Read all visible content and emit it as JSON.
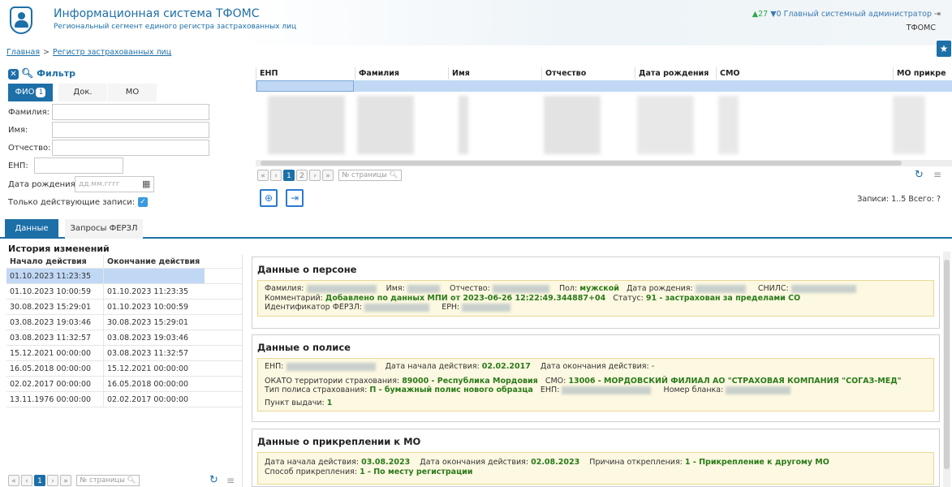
{
  "app": {
    "title": "Информационная система ТФОМС",
    "subtitle": "Региональный сегмент единого регистра застрахованных лиц"
  },
  "user": {
    "up_count": "▲27",
    "down_count": "▼0",
    "role": "Главный системный администратор",
    "org": "ТФОМС"
  },
  "breadcrumb": {
    "home": "Главная",
    "sep": ">",
    "current": "Регистр застрахованных лиц"
  },
  "filter": {
    "title": "Фильтр",
    "tabs": [
      {
        "label": "ФИО",
        "badge": "1"
      },
      {
        "label": "Док."
      },
      {
        "label": "МО"
      }
    ],
    "fields": {
      "surname": "Фамилия:",
      "name": "Имя:",
      "patronymic": "Отчество:",
      "enp": "ЕНП:",
      "birthdate": "Дата рождения:",
      "birthdate_placeholder": "дд.мм.гггг",
      "only_active": "Только действующие записи:"
    }
  },
  "grid": {
    "columns": [
      "ЕНП",
      "Фамилия",
      "Имя",
      "Отчество",
      "Дата рождения",
      "СМО",
      "МО прикре"
    ],
    "pager": {
      "pages": [
        "1",
        "2"
      ],
      "page_placeholder": "№ страницы"
    },
    "records": "Записи: 1..5 Всего: ?"
  },
  "bottom_tabs": [
    "Данные",
    "Запросы ФЕРЗЛ"
  ],
  "history": {
    "title": "История изменений",
    "col_start": "Начало действия",
    "col_end": "Окончание действия",
    "rows": [
      {
        "start": "01.10.2023 11:23:35",
        "end": ""
      },
      {
        "start": "01.10.2023 10:00:59",
        "end": "01.10.2023 11:23:35"
      },
      {
        "start": "30.08.2023 15:29:01",
        "end": "01.10.2023 10:00:59"
      },
      {
        "start": "03.08.2023 19:03:46",
        "end": "30.08.2023 15:29:01"
      },
      {
        "start": "03.08.2023 11:32:57",
        "end": "03.08.2023 19:03:46"
      },
      {
        "start": "15.12.2021 00:00:00",
        "end": "03.08.2023 11:32:57"
      },
      {
        "start": "16.05.2018 00:00:00",
        "end": "15.12.2021 00:00:00"
      },
      {
        "start": "02.02.2017 00:00:00",
        "end": "16.05.2018 00:00:00"
      },
      {
        "start": "13.11.1976 00:00:00",
        "end": "02.02.2017 00:00:00"
      }
    ],
    "pager": {
      "page": "1",
      "page_placeholder": "№ страницы"
    }
  },
  "person": {
    "title": "Данные о персоне",
    "surname_lbl": "Фамилия:",
    "name_lbl": "Имя:",
    "patronymic_lbl": "Отчество:",
    "sex_lbl": "Пол:",
    "sex": "мужской",
    "birth_lbl": "Дата рождения:",
    "snils_lbl": "СНИЛС:",
    "comment_lbl": "Комментарий:",
    "comment": "Добавлено по данных МПИ от 2023-06-26 12:22:49.344887+04",
    "status_lbl": "Статус:",
    "status": "91 - застрахован за пределами СО",
    "ferzl_lbl": "Идентификатор ФЕРЗЛ:",
    "ern_lbl": "ЕРН:"
  },
  "policy": {
    "title": "Данные о полисе",
    "enp_lbl": "ЕНП:",
    "start_lbl": "Дата начала действия:",
    "start": "02.02.2017",
    "end_lbl": "Дата окончания действия:",
    "end": "-",
    "okato_lbl": "ОКАТО территории страхования:",
    "okato": "89000 - Республика Мордовия",
    "smo_lbl": "СМО:",
    "smo": "13006 - МОРДОВСКИЙ ФИЛИАЛ АО \"СТРАХОВАЯ КОМПАНИЯ \"СОГАЗ-МЕД\"",
    "type_lbl": "Тип полиса страхования:",
    "type": "П - бумажный полис нового образца",
    "enp2_lbl": "ЕНП:",
    "blank_lbl": "Номер бланка:",
    "point_lbl": "Пункт выдачи:",
    "point": "1"
  },
  "attach": {
    "title": "Данные о прикреплении к МО",
    "start_lbl": "Дата начала действия:",
    "start": "03.08.2023",
    "end_lbl": "Дата окончания действия:",
    "end": "02.08.2023",
    "reason_lbl": "Причина открепления:",
    "reason": "1 - Прикрепление к другому МО",
    "method_lbl": "Способ прикрепления:",
    "method": "1 - По месту регистрации"
  }
}
